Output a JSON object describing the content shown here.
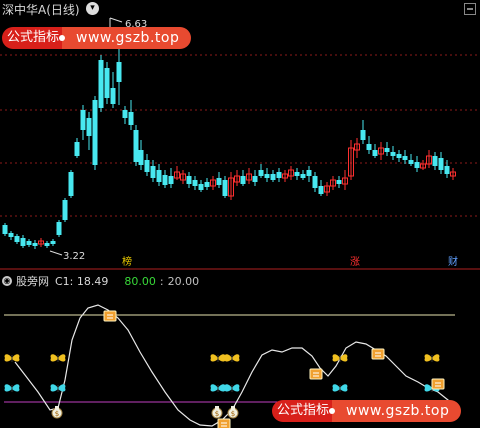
{
  "header": {
    "title": "深中华A(日线)",
    "dropdown_glyph": "▾"
  },
  "price_labels": {
    "high": "6.63",
    "low": "3.22"
  },
  "markers": {
    "bang": "榜",
    "zhang": "涨",
    "cai": "财"
  },
  "watermark": {
    "left_text": "公式指标",
    "right_text": "www.gszb.top"
  },
  "indicator": {
    "name": "股旁网",
    "c1_label": "C1: 18.49",
    "level_high": "80.00",
    "separator": ":",
    "level_low": "20.00"
  },
  "colors": {
    "up": "#ff3030",
    "down": "#48e8f0",
    "line": "#e8e8e8",
    "level_high_line": "#e8e4b0",
    "level_low_line": "#c040c0",
    "grid": "#8b1a1a"
  },
  "icons": [
    "butterfly-icon",
    "money-bag-icon",
    "scroll-icon",
    "minimize-icon",
    "chevron-down-icon"
  ]
}
